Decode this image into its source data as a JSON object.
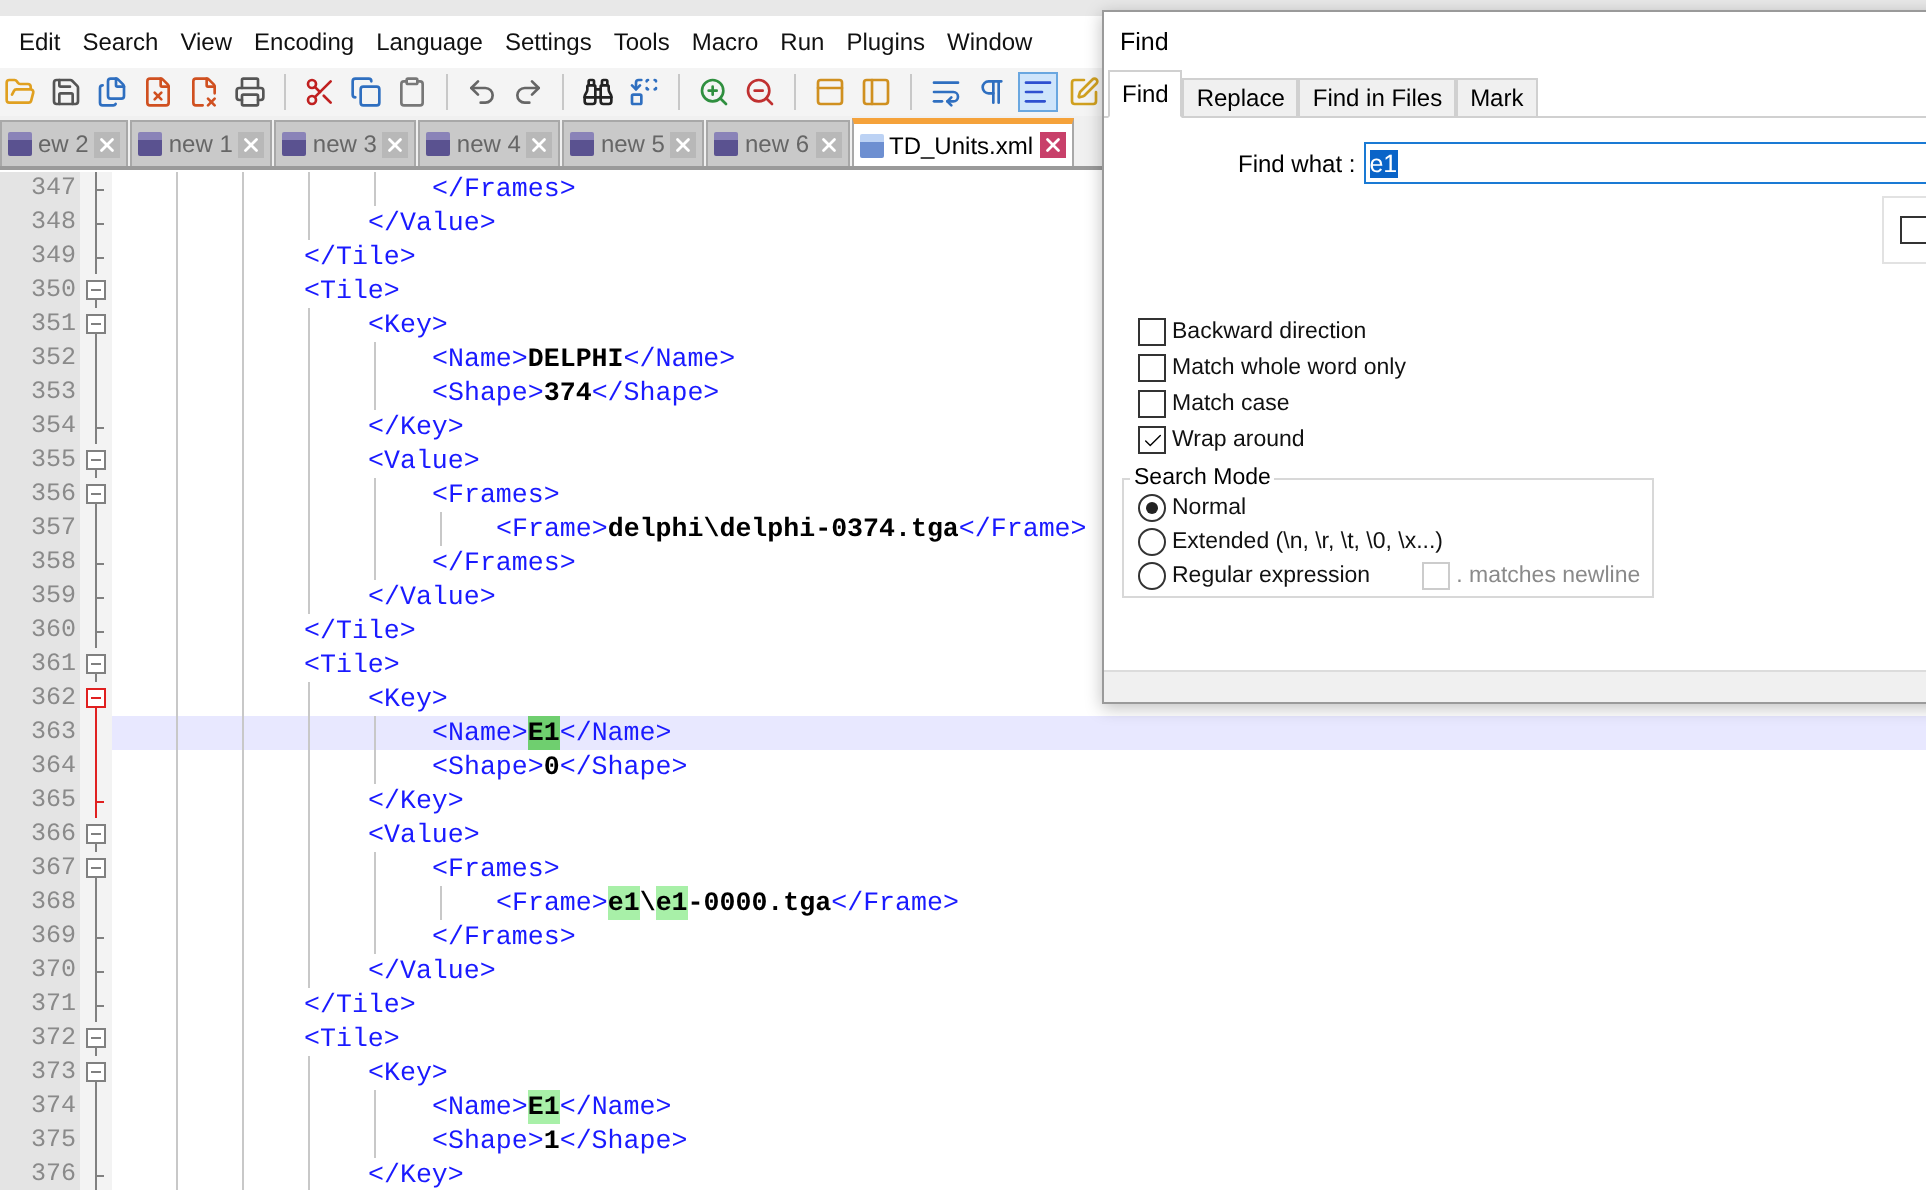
{
  "menu": [
    "Edit",
    "Search",
    "View",
    "Encoding",
    "Language",
    "Settings",
    "Tools",
    "Macro",
    "Run",
    "Plugins",
    "Window"
  ],
  "toolbar": [
    {
      "kind": "button",
      "selected": false
    },
    {
      "kind": "button",
      "selected": false
    },
    {
      "kind": "button",
      "selected": false
    },
    {
      "kind": "button",
      "selected": false
    },
    {
      "kind": "button",
      "selected": false
    },
    {
      "kind": "button",
      "selected": false
    },
    {
      "kind": "separator"
    },
    {
      "kind": "button",
      "selected": false
    },
    {
      "kind": "button",
      "selected": false
    },
    {
      "kind": "button",
      "selected": false
    },
    {
      "kind": "separator"
    },
    {
      "kind": "button",
      "selected": false
    },
    {
      "kind": "button",
      "selected": false
    },
    {
      "kind": "separator"
    },
    {
      "kind": "button",
      "selected": false
    },
    {
      "kind": "button",
      "selected": false
    },
    {
      "kind": "separator"
    },
    {
      "kind": "button",
      "selected": false
    },
    {
      "kind": "button",
      "selected": false
    },
    {
      "kind": "separator"
    },
    {
      "kind": "button",
      "selected": false
    },
    {
      "kind": "button",
      "selected": false
    },
    {
      "kind": "separator"
    },
    {
      "kind": "button",
      "selected": false
    },
    {
      "kind": "button",
      "selected": false
    },
    {
      "kind": "button",
      "selected": true
    },
    {
      "kind": "button",
      "selected": false
    }
  ],
  "tabs": [
    {
      "label": "ew 2",
      "selected": false
    },
    {
      "label": "new 1",
      "selected": false
    },
    {
      "label": "new 3",
      "selected": false
    },
    {
      "label": "new 4",
      "selected": false
    },
    {
      "label": "new 5",
      "selected": false
    },
    {
      "label": "new 6",
      "selected": false
    },
    {
      "label": "TD_Units.xml",
      "selected": true
    }
  ],
  "editor": {
    "lines": [
      {
        "number": "347",
        "fold": {
          "kind": "tick",
          "active": false
        },
        "current": false,
        "segments": [
          {
            "kind": "tag",
            "text": "                    </Frames>"
          }
        ]
      },
      {
        "number": "348",
        "fold": {
          "kind": "tick",
          "active": false
        },
        "current": false,
        "segments": [
          {
            "kind": "tag",
            "text": "                </Value>"
          }
        ]
      },
      {
        "number": "349",
        "fold": {
          "kind": "tick",
          "active": false
        },
        "current": false,
        "segments": [
          {
            "kind": "tag",
            "text": "            </Tile>"
          }
        ]
      },
      {
        "number": "350",
        "fold": {
          "kind": "minus",
          "active": false
        },
        "current": false,
        "segments": [
          {
            "kind": "tag",
            "text": "            <Tile>"
          }
        ]
      },
      {
        "number": "351",
        "fold": {
          "kind": "minus",
          "active": false
        },
        "current": false,
        "segments": [
          {
            "kind": "tag",
            "text": "                <Key>"
          }
        ]
      },
      {
        "number": "352",
        "fold": {
          "kind": "line",
          "active": false
        },
        "current": false,
        "segments": [
          {
            "kind": "tag",
            "text": "                    <Name>"
          },
          {
            "kind": "text",
            "text": "DELPHI"
          },
          {
            "kind": "tag",
            "text": "</Name>"
          }
        ]
      },
      {
        "number": "353",
        "fold": {
          "kind": "line",
          "active": false
        },
        "current": false,
        "segments": [
          {
            "kind": "tag",
            "text": "                    <Shape>"
          },
          {
            "kind": "text",
            "text": "374"
          },
          {
            "kind": "tag",
            "text": "</Shape>"
          }
        ]
      },
      {
        "number": "354",
        "fold": {
          "kind": "tick",
          "active": false
        },
        "current": false,
        "segments": [
          {
            "kind": "tag",
            "text": "                </Key>"
          }
        ]
      },
      {
        "number": "355",
        "fold": {
          "kind": "minus",
          "active": false
        },
        "current": false,
        "segments": [
          {
            "kind": "tag",
            "text": "                <Value>"
          }
        ]
      },
      {
        "number": "356",
        "fold": {
          "kind": "minus",
          "active": false
        },
        "current": false,
        "segments": [
          {
            "kind": "tag",
            "text": "                    <Frames>"
          }
        ]
      },
      {
        "number": "357",
        "fold": {
          "kind": "line",
          "active": false
        },
        "current": false,
        "segments": [
          {
            "kind": "tag",
            "text": "                        <Frame>"
          },
          {
            "kind": "text",
            "text": "delphi\\delphi-0374.tga"
          },
          {
            "kind": "tag",
            "text": "</Frame>"
          }
        ]
      },
      {
        "number": "358",
        "fold": {
          "kind": "tick",
          "active": false
        },
        "current": false,
        "segments": [
          {
            "kind": "tag",
            "text": "                    </Frames>"
          }
        ]
      },
      {
        "number": "359",
        "fold": {
          "kind": "tick",
          "active": false
        },
        "current": false,
        "segments": [
          {
            "kind": "tag",
            "text": "                </Value>"
          }
        ]
      },
      {
        "number": "360",
        "fold": {
          "kind": "tick",
          "active": false
        },
        "current": false,
        "segments": [
          {
            "kind": "tag",
            "text": "            </Tile>"
          }
        ]
      },
      {
        "number": "361",
        "fold": {
          "kind": "minus",
          "active": false
        },
        "current": false,
        "segments": [
          {
            "kind": "tag",
            "text": "            <Tile>"
          }
        ]
      },
      {
        "number": "362",
        "fold": {
          "kind": "minus",
          "active": true
        },
        "current": false,
        "segments": [
          {
            "kind": "tag",
            "text": "                <Key>"
          }
        ]
      },
      {
        "number": "363",
        "fold": {
          "kind": "line",
          "active": true
        },
        "current": true,
        "segments": [
          {
            "kind": "tag",
            "text": "                    <Name>"
          },
          {
            "kind": "current-match",
            "text": "E1"
          },
          {
            "kind": "tag",
            "text": "</Name>"
          }
        ]
      },
      {
        "number": "364",
        "fold": {
          "kind": "line",
          "active": true
        },
        "current": false,
        "segments": [
          {
            "kind": "tag",
            "text": "                    <Shape>"
          },
          {
            "kind": "text",
            "text": "0"
          },
          {
            "kind": "tag",
            "text": "</Shape>"
          }
        ]
      },
      {
        "number": "365",
        "fold": {
          "kind": "tick",
          "active": true
        },
        "current": false,
        "segments": [
          {
            "kind": "tag",
            "text": "                </Key>"
          }
        ]
      },
      {
        "number": "366",
        "fold": {
          "kind": "minus",
          "active": false
        },
        "current": false,
        "segments": [
          {
            "kind": "tag",
            "text": "                <Value>"
          }
        ]
      },
      {
        "number": "367",
        "fold": {
          "kind": "minus",
          "active": false
        },
        "current": false,
        "segments": [
          {
            "kind": "tag",
            "text": "                    <Frames>"
          }
        ]
      },
      {
        "number": "368",
        "fold": {
          "kind": "line",
          "active": false
        },
        "current": false,
        "segments": [
          {
            "kind": "tag",
            "text": "                        <Frame>"
          },
          {
            "kind": "match",
            "text": "e1"
          },
          {
            "kind": "text",
            "text": "\\"
          },
          {
            "kind": "match",
            "text": "e1"
          },
          {
            "kind": "text",
            "text": "-0000.tga"
          },
          {
            "kind": "tag",
            "text": "</Frame>"
          }
        ]
      },
      {
        "number": "369",
        "fold": {
          "kind": "tick",
          "active": false
        },
        "current": false,
        "segments": [
          {
            "kind": "tag",
            "text": "                    </Frames>"
          }
        ]
      },
      {
        "number": "370",
        "fold": {
          "kind": "tick",
          "active": false
        },
        "current": false,
        "segments": [
          {
            "kind": "tag",
            "text": "                </Value>"
          }
        ]
      },
      {
        "number": "371",
        "fold": {
          "kind": "tick",
          "active": false
        },
        "current": false,
        "segments": [
          {
            "kind": "tag",
            "text": "            </Tile>"
          }
        ]
      },
      {
        "number": "372",
        "fold": {
          "kind": "minus",
          "active": false
        },
        "current": false,
        "segments": [
          {
            "kind": "tag",
            "text": "            <Tile>"
          }
        ]
      },
      {
        "number": "373",
        "fold": {
          "kind": "minus",
          "active": false
        },
        "current": false,
        "segments": [
          {
            "kind": "tag",
            "text": "                <Key>"
          }
        ]
      },
      {
        "number": "374",
        "fold": {
          "kind": "line",
          "active": false
        },
        "current": false,
        "segments": [
          {
            "kind": "tag",
            "text": "                    <Name>"
          },
          {
            "kind": "match",
            "text": "E1"
          },
          {
            "kind": "tag",
            "text": "</Name>"
          }
        ]
      },
      {
        "number": "375",
        "fold": {
          "kind": "line",
          "active": false
        },
        "current": false,
        "segments": [
          {
            "kind": "tag",
            "text": "                    <Shape>"
          },
          {
            "kind": "text",
            "text": "1"
          },
          {
            "kind": "tag",
            "text": "</Shape>"
          }
        ]
      },
      {
        "number": "376",
        "fold": {
          "kind": "tick",
          "active": false
        },
        "current": false,
        "segments": [
          {
            "kind": "tag",
            "text": "                </Key>"
          }
        ]
      }
    ]
  },
  "find_dialog": {
    "title": "Find",
    "tabs": [
      {
        "label": "Find",
        "selected": true
      },
      {
        "label": "Replace",
        "selected": false
      },
      {
        "label": "Find in Files",
        "selected": false
      },
      {
        "label": "Mark",
        "selected": false
      }
    ],
    "find_what": {
      "label": "Find what :",
      "value": "e1"
    },
    "side_checkbox": {
      "checked": false
    },
    "options": [
      {
        "label": "Backward direction",
        "checked": false
      },
      {
        "label": "Match whole word only",
        "checked": false
      },
      {
        "label": "Match case",
        "checked": false
      },
      {
        "label": "Wrap around",
        "checked": true
      }
    ],
    "search_mode": {
      "title": "Search Mode",
      "modes": [
        {
          "label": "Normal",
          "selected": true
        },
        {
          "label": "Extended (\\n, \\r, \\t, \\0, \\x...)",
          "selected": false
        },
        {
          "label": "Regular expression",
          "selected": false
        }
      ],
      "dot_newline": {
        "label": ". matches newline",
        "checked": false,
        "disabled": true
      }
    }
  }
}
